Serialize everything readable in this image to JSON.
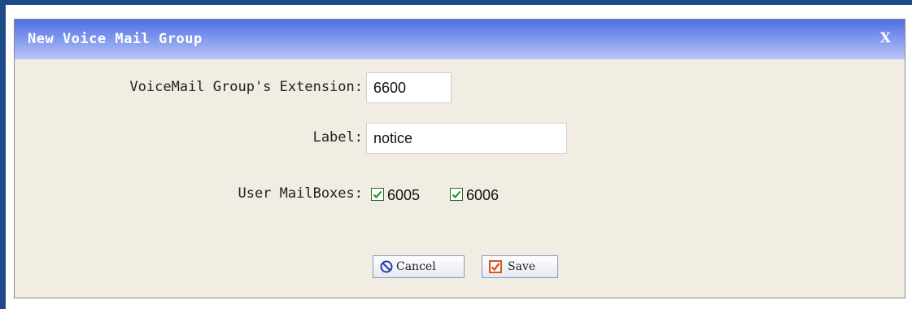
{
  "dialog": {
    "title": "New Voice Mail Group",
    "close_label": "X"
  },
  "form": {
    "extension_label": "VoiceMail Group's Extension:",
    "extension_value": "6600",
    "label_label": "Label:",
    "label_value": "notice",
    "mailboxes_label": "User MailBoxes:",
    "mailboxes": [
      {
        "label": "6005",
        "checked": true
      },
      {
        "label": "6006",
        "checked": true
      }
    ]
  },
  "buttons": {
    "cancel_label": "Cancel",
    "save_label": "Save"
  },
  "colors": {
    "title_gradient_start": "#4d6fe2",
    "title_gradient_end": "#b9c6f7",
    "dialog_background": "#f1ede2",
    "frame_border": "#1f4a8a",
    "cancel_icon": "#1f3fa8",
    "save_icon": "#d9531e",
    "checkbox_check": "#1e8a1e"
  },
  "icons": {
    "cancel": "no-entry-circle-icon",
    "save": "checkbox-check-icon"
  }
}
